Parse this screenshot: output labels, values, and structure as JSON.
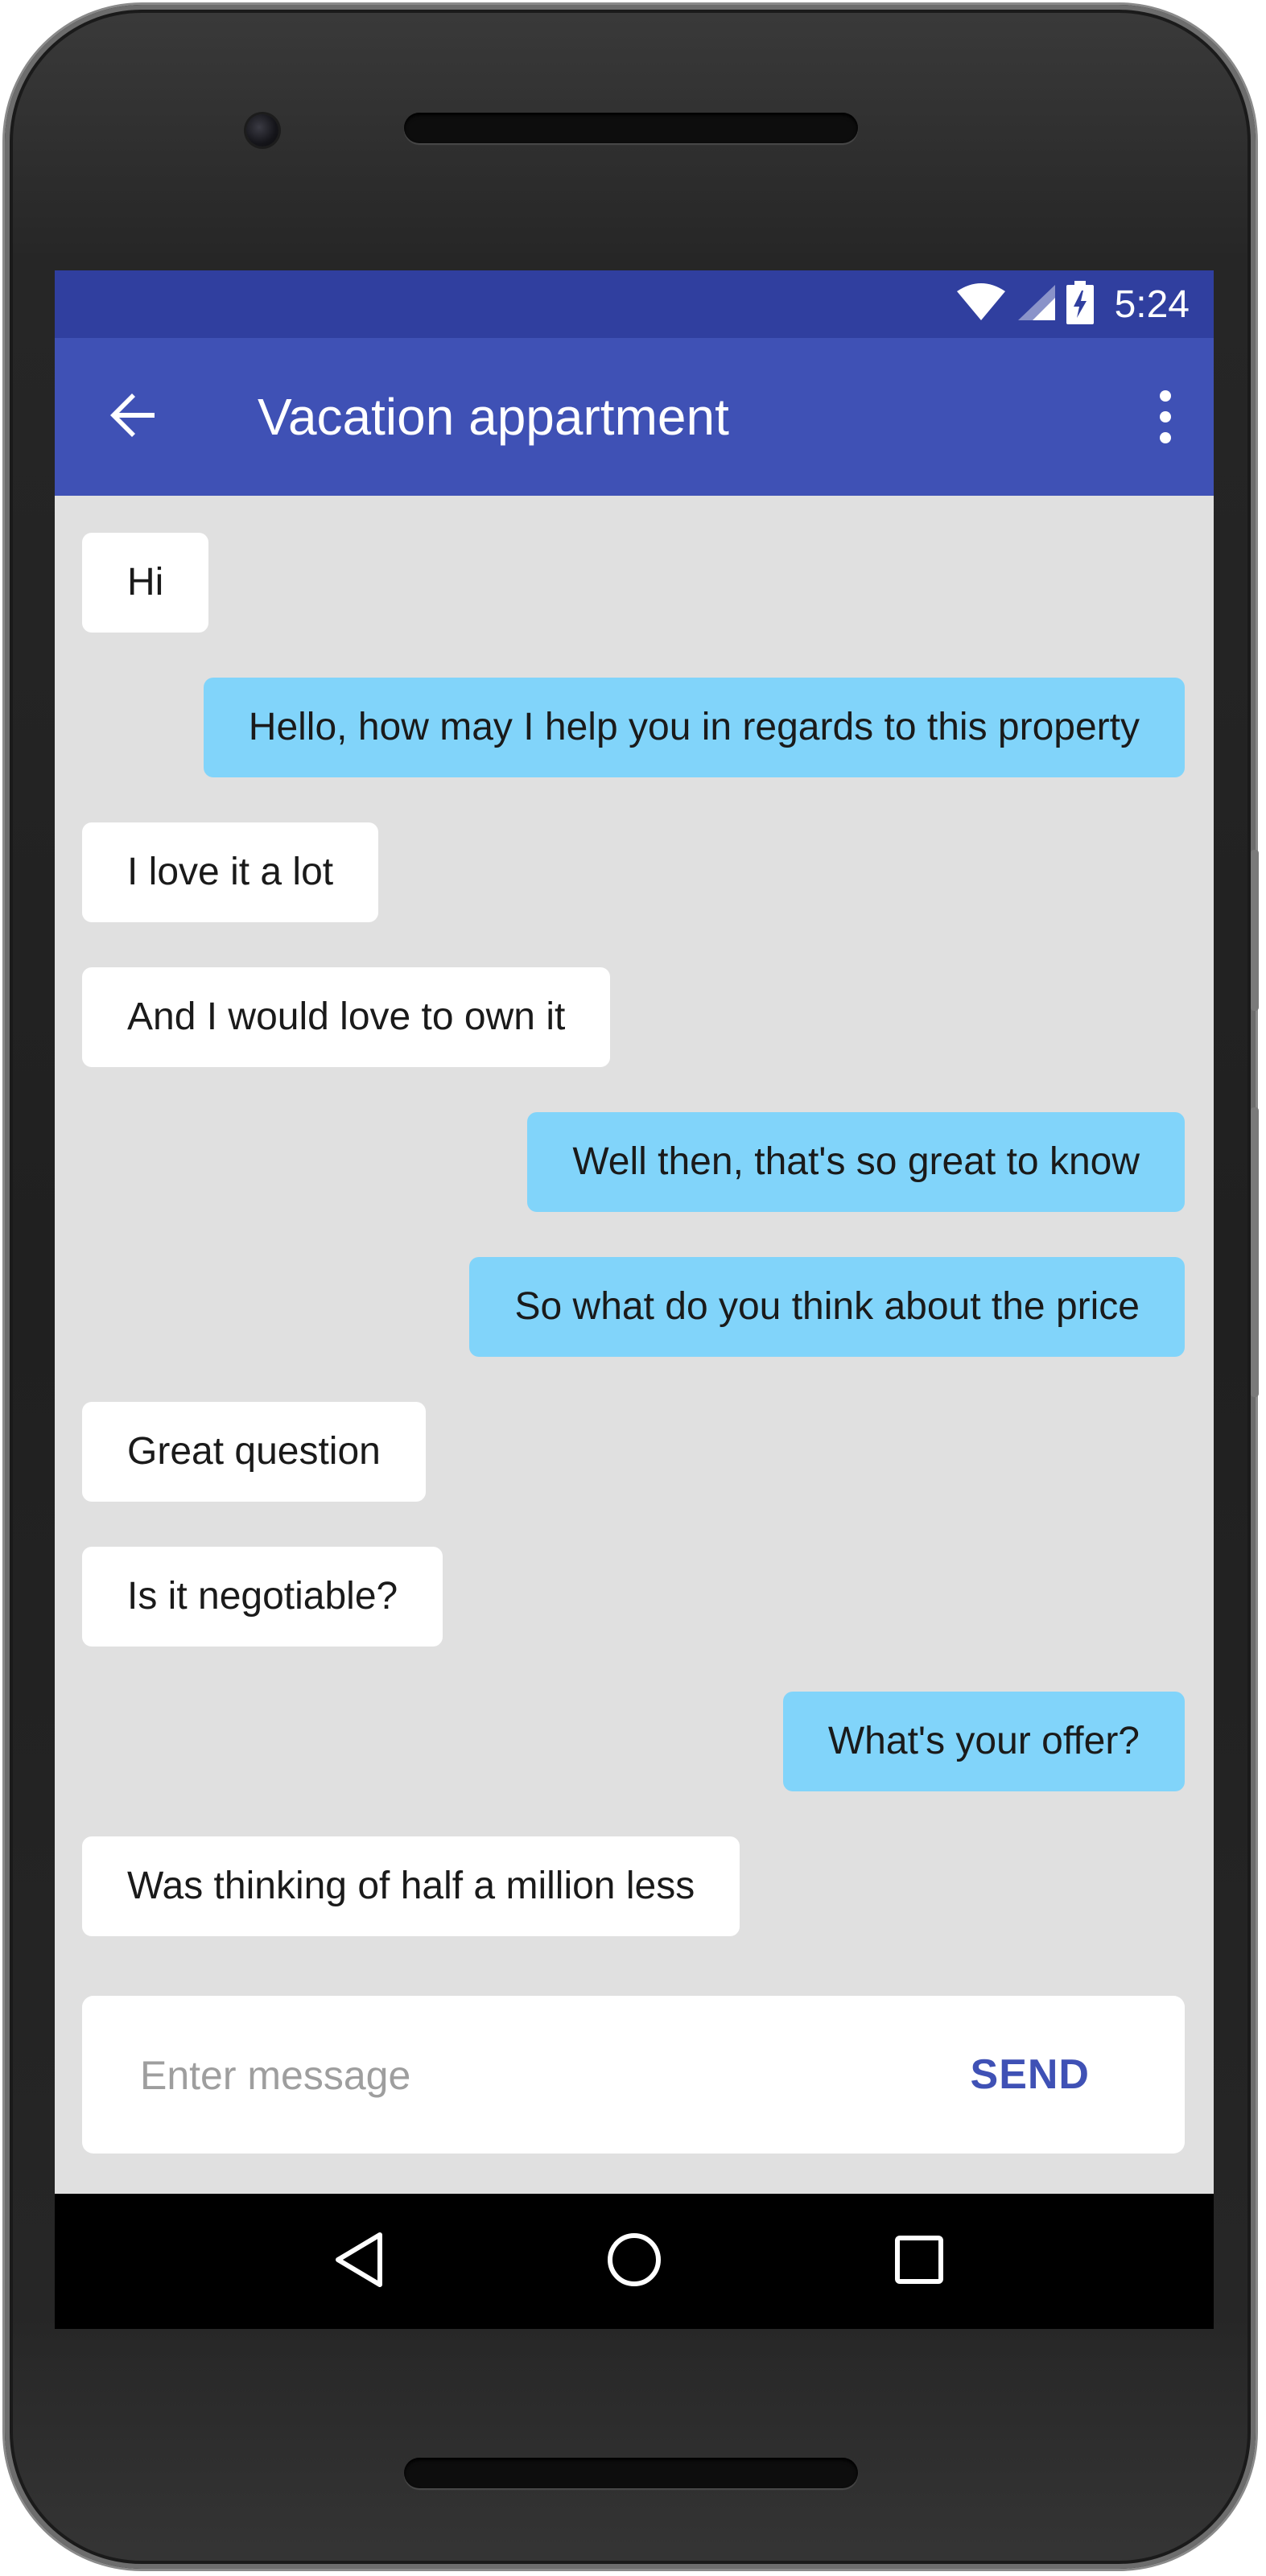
{
  "status_bar": {
    "time": "5:24",
    "icons": [
      "wifi-icon",
      "signal-icon",
      "battery-charging-icon"
    ]
  },
  "app_bar": {
    "title": "Vacation appartment",
    "back_icon": "arrow-back-icon",
    "menu_icon": "more-vert-icon"
  },
  "messages": [
    {
      "direction": "in",
      "text": "Hi"
    },
    {
      "direction": "out",
      "text": "Hello, how may I help you in regards to this property"
    },
    {
      "direction": "in",
      "text": "I love it a lot"
    },
    {
      "direction": "in",
      "text": "And I would love to own it"
    },
    {
      "direction": "out",
      "text": "Well then, that's so great to know"
    },
    {
      "direction": "out",
      "text": "So what do you think about the price"
    },
    {
      "direction": "in",
      "text": "Great question"
    },
    {
      "direction": "in",
      "text": "Is it negotiable?"
    },
    {
      "direction": "out",
      "text": "What's your offer?"
    },
    {
      "direction": "in",
      "text": "Was thinking of half a million less"
    }
  ],
  "composer": {
    "placeholder": "Enter message",
    "value": "",
    "send_label": "SEND"
  },
  "nav_bar": {
    "icons": [
      "nav-back-icon",
      "nav-home-icon",
      "nav-recents-icon"
    ]
  },
  "colors": {
    "status_bar": "#303f9f",
    "app_bar": "#3f51b5",
    "incoming_bubble": "#ffffff",
    "outgoing_bubble": "#81d4fa",
    "chat_background": "#e0e0e0",
    "accent": "#3f51b5"
  }
}
